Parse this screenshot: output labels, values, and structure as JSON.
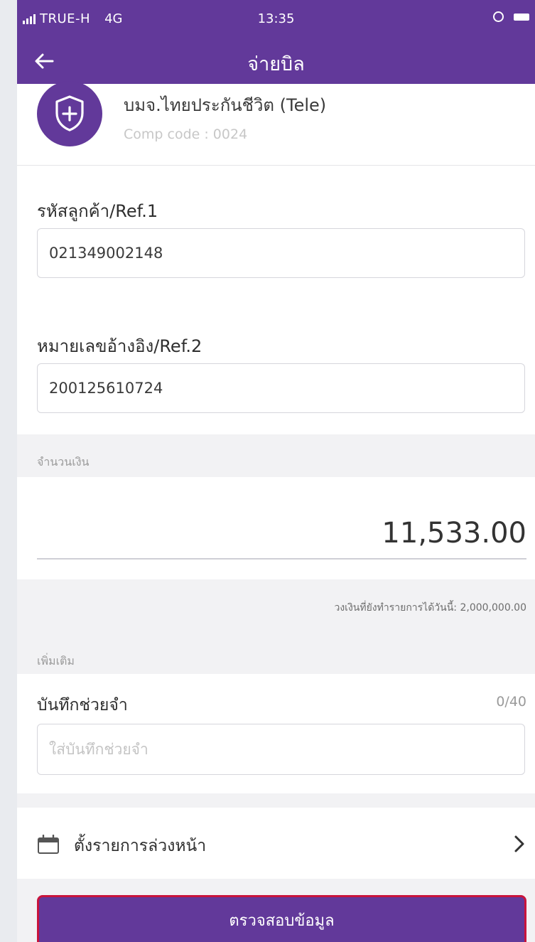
{
  "status_bar": {
    "carrier": "TRUE-H",
    "network": "4G",
    "time": "13:35"
  },
  "header": {
    "title": "จ่ายบิล",
    "back_icon": "arrow-left-icon",
    "background": "#62399a"
  },
  "company": {
    "name": "บมจ.ไทยประกันชีวิต (Tele)",
    "code_text": "Comp code : 0024",
    "logo_icon": "shield-plus-icon"
  },
  "ref1": {
    "label": "รหัสลูกค้า/Ref.1",
    "value": "021349002148"
  },
  "ref2": {
    "label": "หมายเลขอ้างอิง/Ref.2",
    "value": "200125610724"
  },
  "amount": {
    "section_label": "จำนวนเงิน",
    "value": "11,533.00",
    "limit_text": "วงเงินที่ยังทำรายการได้วันนี้: 2,000,000.00"
  },
  "more": {
    "section_label": "เพิ่มเติม",
    "note_title": "บันทึกช่วยจำ",
    "note_counter": "0/40",
    "note_placeholder": "ใส่บันทึกช่วยจำ"
  },
  "schedule": {
    "label": "ตั้งรายการล่วงหน้า",
    "icon": "calendar-icon",
    "chevron": "chevron-right-icon"
  },
  "verify_button": {
    "label": "ตรวจสอบข้อมูล",
    "border_color": "#c8143c"
  }
}
